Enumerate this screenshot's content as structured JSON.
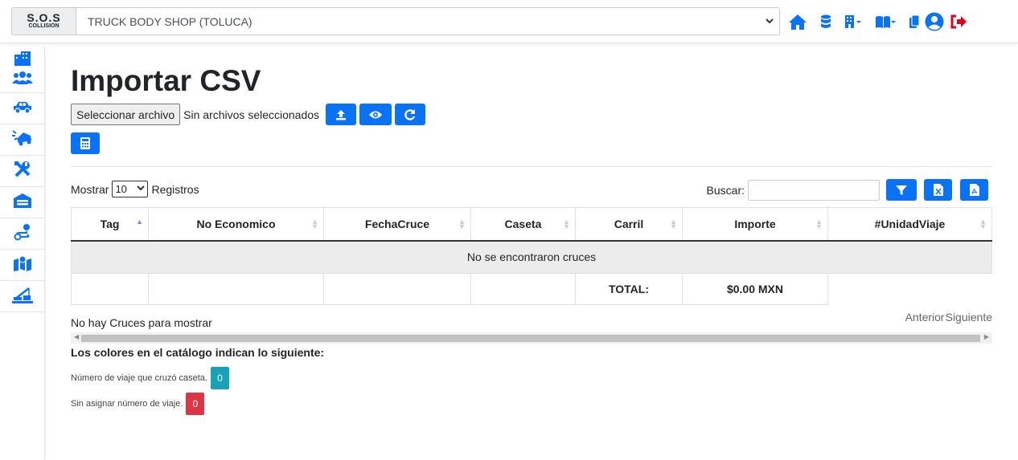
{
  "topbar": {
    "logo_main": "S.O.S",
    "logo_sub": "COLLISION",
    "company": "TRUCK BODY SHOP (TOLUCA)",
    "icons": [
      "home-icon",
      "database-icon",
      "building-dropdown-icon",
      "book-dropdown-icon",
      "copy-icon",
      "user-circle-icon",
      "logout-icon"
    ]
  },
  "sidebar": {
    "items": [
      "buildings-icon",
      "users-icon",
      "car-icon",
      "car-crash-icon",
      "tools-icon",
      "warehouse-icon",
      "route-icon",
      "map-icon",
      "crane-icon"
    ]
  },
  "page": {
    "title": "Importar CSV",
    "file_button": "Seleccionar archivo",
    "file_status": "Sin archivos seleccionados"
  },
  "table_controls": {
    "show_label": "Mostrar",
    "page_length": "10",
    "records_label": "Registros",
    "search_label": "Buscar:"
  },
  "table": {
    "columns": [
      "Tag",
      "No Economico",
      "FechaCruce",
      "Caseta",
      "Carril",
      "Importe",
      "#UnidadViaje"
    ],
    "empty_message": "No se encontraron cruces",
    "total_label": "TOTAL:",
    "total_value": "$0.00 MXN"
  },
  "footer": {
    "info": "No hay Cruces para mostrar",
    "prev": "Anterior",
    "next": "Siguiente"
  },
  "legend": {
    "title": "Los colores en el catálogo indican lo siguiente:",
    "items": [
      {
        "label": "Número de viaje que cruzó caseta.",
        "count": "0",
        "color": "#17a2b8"
      },
      {
        "label": "Sin asignar número de viaje.",
        "count": "0",
        "color": "#dc3545"
      }
    ]
  },
  "colors": {
    "primary": "#0a73f5",
    "logout": "#e3001b"
  }
}
